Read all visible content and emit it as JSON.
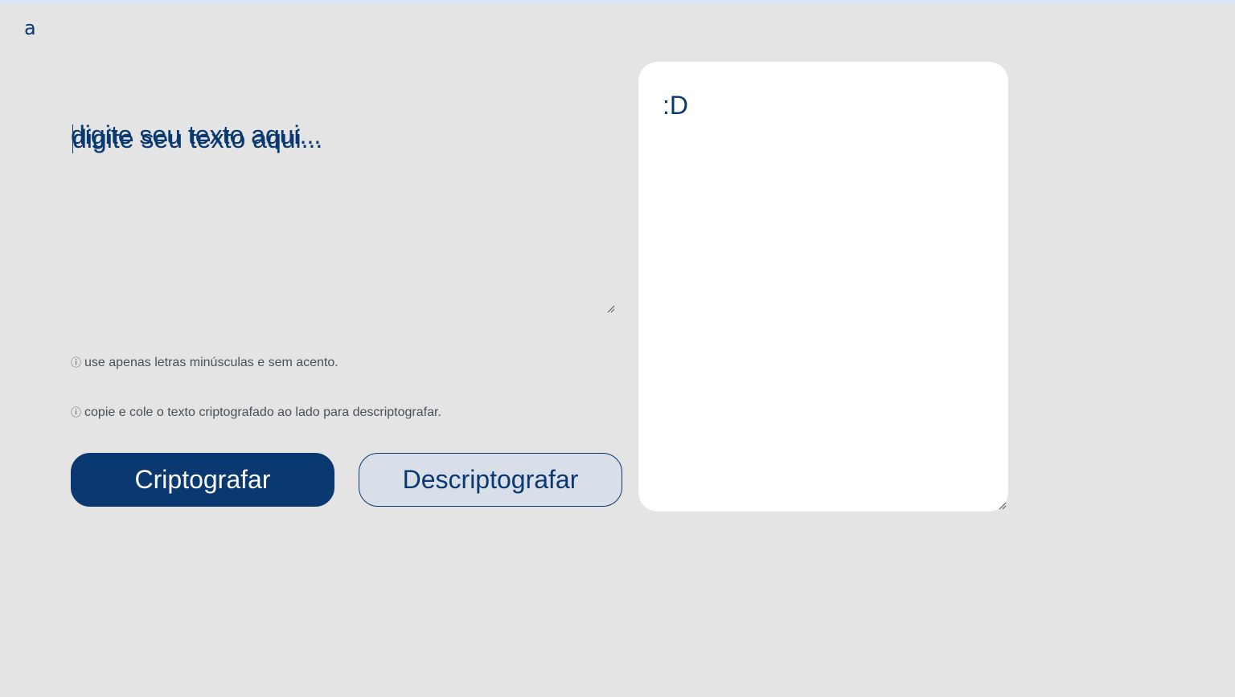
{
  "logo": {
    "text": "a"
  },
  "input": {
    "placeholder": "digite seu texto aqui...",
    "value": ""
  },
  "hints": [
    {
      "icon": "info-icon",
      "text": "use apenas letras minúsculas e sem acento."
    },
    {
      "icon": "info-icon",
      "text": "copie e cole o texto criptografado ao lado para descriptografar."
    }
  ],
  "buttons": {
    "encrypt_label": "Criptografar",
    "decrypt_label": "Descriptografar"
  },
  "output": {
    "text": ":D"
  },
  "colors": {
    "background": "#e4e4e4",
    "primary": "#0a3871",
    "secondary_button_bg": "#d8dfe8",
    "panel": "#ffffff",
    "hint_text": "#495057"
  }
}
